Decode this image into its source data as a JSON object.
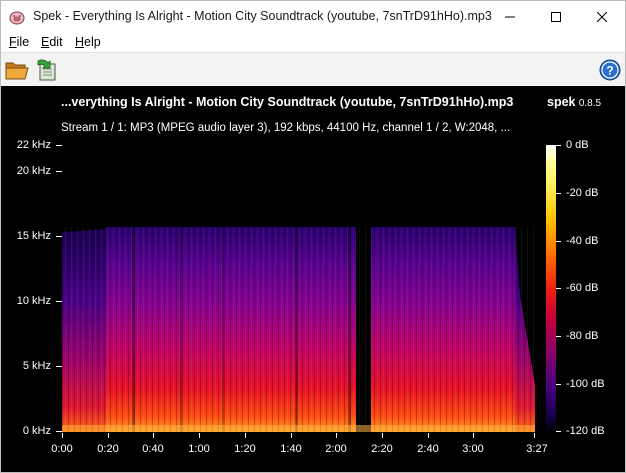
{
  "window": {
    "title": "Spek - Everything Is Alright - Motion City Soundtrack (youtube, 7snTrD91hHo).mp3",
    "app_icon": "spek-pig-icon"
  },
  "menu": {
    "items": [
      {
        "underline": "F",
        "rest": "ile"
      },
      {
        "underline": "E",
        "rest": "dit"
      },
      {
        "underline": "H",
        "rest": "elp"
      }
    ]
  },
  "toolbar": {
    "open_icon": "folder-open-icon",
    "save_icon": "save-icon",
    "help_icon": "help-icon"
  },
  "spectrogram": {
    "header_title": "...verything Is Alright - Motion City Soundtrack (youtube, 7snTrD91hHo).mp3",
    "brand_name": "spek",
    "brand_version": "0.8.5",
    "stream_info": "Stream 1 / 1: MP3 (MPEG audio layer 3), 192 kbps, 44100 Hz, channel 1 / 2, W:2048, ...",
    "y_labels": [
      "22 kHz",
      "20 kHz",
      "15 kHz",
      "10 kHz",
      "5 kHz",
      "0 kHz"
    ],
    "x_labels": [
      "0:00",
      "0:20",
      "0:40",
      "1:00",
      "1:20",
      "1:40",
      "2:00",
      "2:20",
      "2:40",
      "3:00",
      "3:27"
    ],
    "colorbar_labels": [
      "0 dB",
      "-20 dB",
      "-40 dB",
      "-60 dB",
      "-80 dB",
      "-100 dB",
      "-120 dB"
    ],
    "cutoff_khz": 16,
    "duration_s": 207,
    "silent_gap_s": [
      123,
      128
    ]
  },
  "colors": {
    "panel_bg": "#000000",
    "text": "#ffffff",
    "hot": "#ff6a00",
    "mid": "#c0006a",
    "cool": "#3a0090"
  }
}
